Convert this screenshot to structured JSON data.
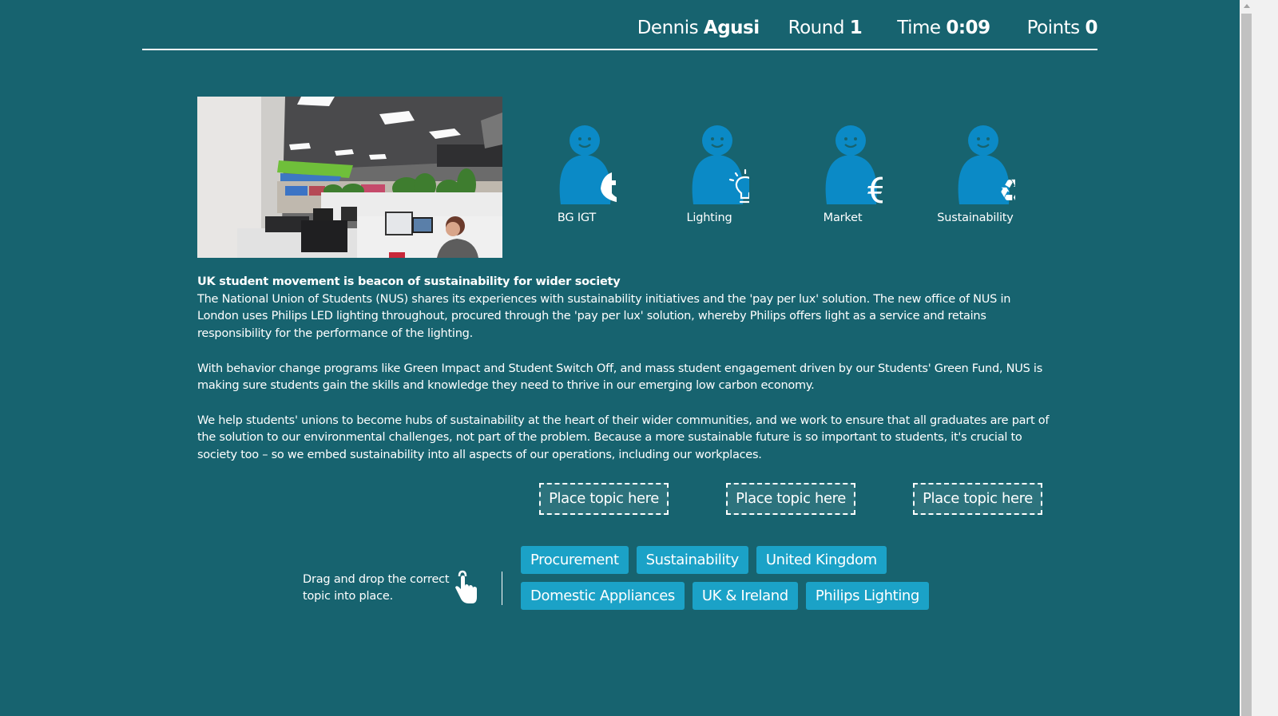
{
  "header": {
    "player_first_name": "Dennis",
    "player_last_name": "Agusi",
    "round_label": "Round",
    "round_value": "1",
    "time_label": "Time",
    "time_value": "0:09",
    "points_label": "Points",
    "points_value": "0"
  },
  "hero_image": {
    "description": "Open-plan office with LED ceiling panels, plants and a man working at a desk"
  },
  "personas": [
    {
      "label": "BG IGT",
      "icon": "appliance-icon"
    },
    {
      "label": "Lighting",
      "icon": "lightbulb-icon"
    },
    {
      "label": "Market",
      "icon": "euro-icon"
    },
    {
      "label": "Sustainability",
      "icon": "recycle-icon"
    }
  ],
  "article": {
    "title": "UK student movement is beacon of sustainability for wider society",
    "paragraphs": [
      "The National Union of Students (NUS) shares its experiences with sustainability initiatives and the 'pay per lux' solution. The new office of NUS in London uses Philips LED lighting throughout, procured through the 'pay per lux' solution, whereby Philips offers light as a service and retains responsibility for the performance of the lighting.",
      "With behavior change programs like Green Impact and Student Switch Off, and mass student engagement driven by our Students' Green Fund, NUS is making sure students gain the skills and knowledge they need to thrive in our emerging low carbon economy.",
      "We help students' unions to become hubs of sustainability at the heart of their wider communities, and we work to ensure that all graduates are part of the solution to our environmental challenges, not part of the problem. Because a more sustainable future is so important to students, it's crucial to society too – so we embed sustainability into all aspects of our operations, including our workplaces."
    ]
  },
  "drop_zones": [
    {
      "placeholder": "Place topic here"
    },
    {
      "placeholder": "Place topic here"
    },
    {
      "placeholder": "Place topic here"
    }
  ],
  "instructions": {
    "text": "Drag and drop the correct topic into place.",
    "icon": "hand-pointer-icon"
  },
  "topics": {
    "row1": [
      "Procurement",
      "Sustainability",
      "United Kingdom"
    ],
    "row2": [
      "Domestic Appliances",
      "UK & Ireland",
      "Philips Lighting"
    ]
  },
  "colors": {
    "background": "#17636f",
    "persona_blue": "#0b8ac6",
    "chip_blue": "#1ba2c7",
    "drop_zone_fill": "#2d737d"
  }
}
